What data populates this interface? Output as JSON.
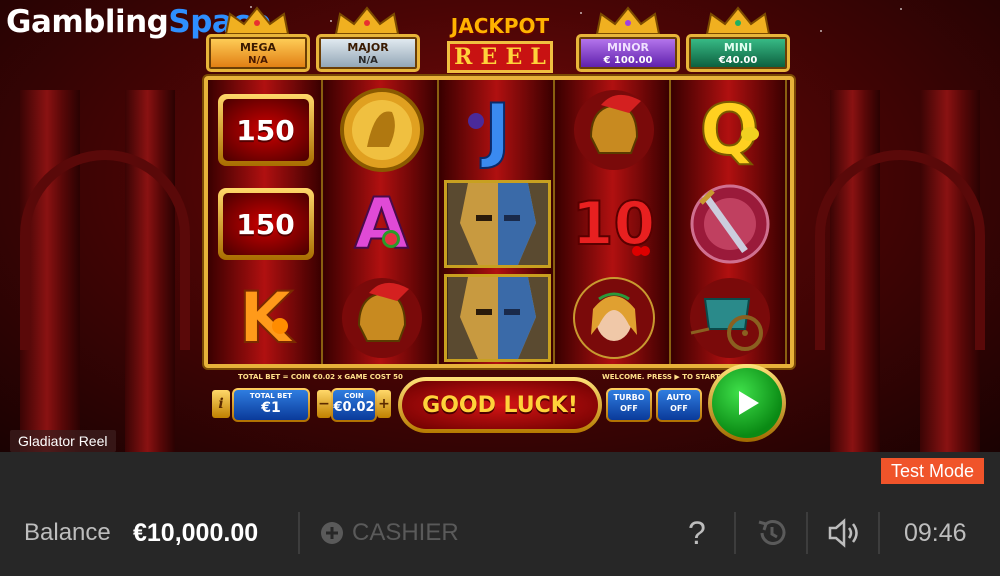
{
  "branding": {
    "logo_main": "Gambling",
    "logo_accent": "Space"
  },
  "jackpots": {
    "title_line1": "JACKPOT",
    "title_line2": [
      "R",
      "E",
      "E",
      "L"
    ],
    "mega": {
      "label": "MEGA",
      "value": "N/A",
      "color": "#f7b22a"
    },
    "major": {
      "label": "MAJOR",
      "value": "N/A",
      "color": "#b5c5d2"
    },
    "minor": {
      "label": "MINOR",
      "value": "€ 100.00",
      "color": "#8a3fd6"
    },
    "mini": {
      "label": "MINI",
      "value": "€40.00",
      "color": "#1e8a5a"
    }
  },
  "reels": {
    "r1": [
      "150",
      "150",
      "K"
    ],
    "r2": [
      "gold-coin-emperor",
      "A",
      "gladiator-helmet"
    ],
    "r4": [
      "gladiator-helmet",
      "10",
      "woman-portrait"
    ],
    "r5": [
      "Q",
      "sword-shield",
      "chariot"
    ],
    "r1_icons": [
      "coin-badge-150",
      "coin-badge-150",
      "letter-k-orange"
    ],
    "r3_icons": [
      "letter-j-plum",
      "gladiator-face-top",
      "gladiator-face-bottom"
    ]
  },
  "controls": {
    "total_bet_info": "TOTAL BET = COIN €0.02 x GAME COST 50",
    "welcome": "WELCOME. PRESS ▶ TO START",
    "info_label": "i",
    "total_bet_label": "TOTAL BET",
    "total_bet_value": "€1",
    "coin_label": "COIN",
    "coin_value": "€0.02",
    "minus_label": "−",
    "plus_label": "+",
    "good_luck": "GOOD LUCK!",
    "turbo_label": "TURBO",
    "turbo_value": "OFF",
    "auto_label": "AUTO",
    "auto_value": "OFF"
  },
  "game_name": "Gladiator Reel",
  "footer": {
    "test_mode": "Test Mode",
    "balance_label": "Balance",
    "balance_value": "€10,000.00",
    "cashier_label": "CASHIER",
    "help_label": "?",
    "time": "09:46"
  }
}
